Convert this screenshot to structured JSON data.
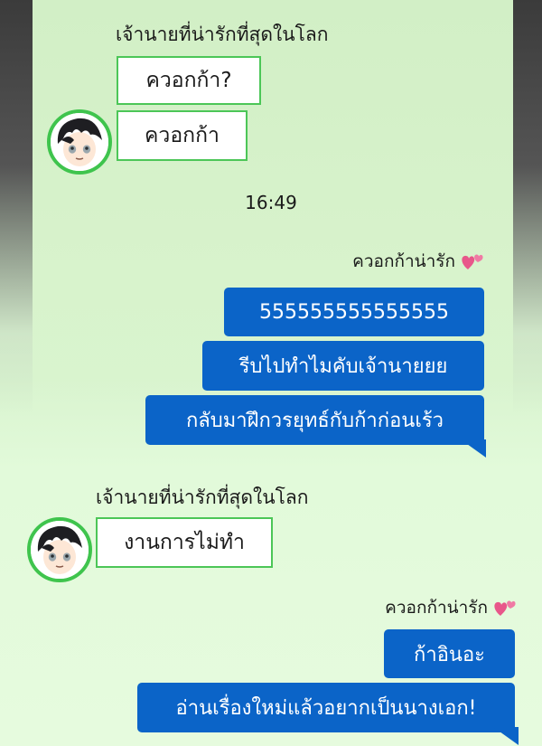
{
  "chat": {
    "other_name_1": "เจ้านายที่น่ารักที่สุดในโลก",
    "other_name_2": "เจ้านายที่น่ารักที่สุดในโลก",
    "my_name_1": "ควอกก้าน่ารัก",
    "my_name_2": "ควอกก้าน่ารัก",
    "timestamp": "16:49",
    "messages": [
      {
        "from": "other",
        "text": "ควอกก้า?"
      },
      {
        "from": "other",
        "text": "ควอกก้า"
      },
      {
        "from": "me",
        "text": "555555555555555"
      },
      {
        "from": "me",
        "text": "รีบไปทำไมคับเจ้านายยย"
      },
      {
        "from": "me",
        "text": "กลับมาฝึกวรยุทธ์กับก้าก่อนเร้ว"
      },
      {
        "from": "other",
        "text": "งานการไม่ทำ"
      },
      {
        "from": "me",
        "text": "ก้าอินอะ"
      },
      {
        "from": "me",
        "text": "อ่านเรื่องใหม่แล้วอยากเป็นนางเอก!"
      }
    ]
  },
  "colors": {
    "incoming_border": "#4cc657",
    "outgoing_bg": "#0b64c8",
    "background": "#e2fada",
    "heart": "#e8578a"
  },
  "icons": {
    "heart": "two-hearts-icon",
    "avatar": "black-haired-boy-avatar"
  }
}
